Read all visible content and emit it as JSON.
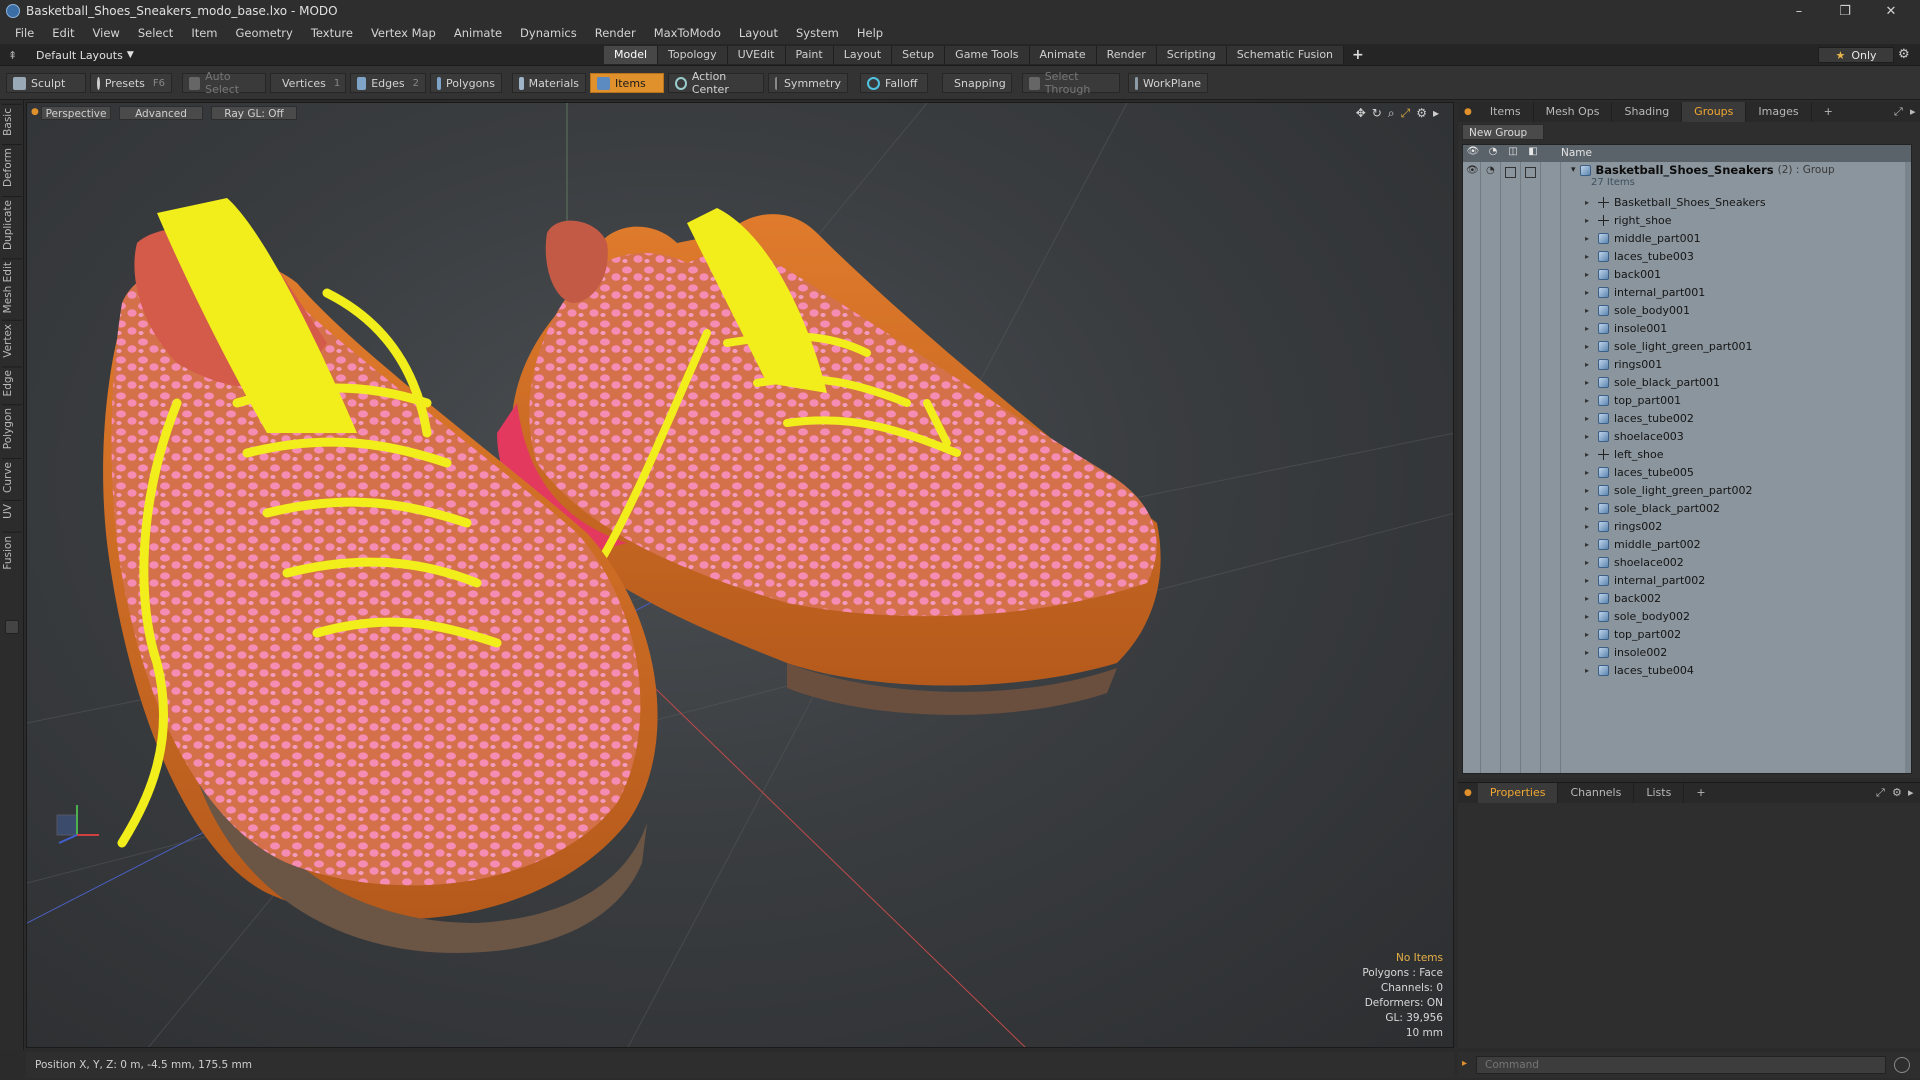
{
  "window": {
    "title": "Basketball_Shoes_Sneakers_modo_base.lxo - MODO",
    "controls": [
      "–",
      "❐",
      "✕"
    ]
  },
  "menu": [
    "File",
    "Edit",
    "View",
    "Select",
    "Item",
    "Geometry",
    "Texture",
    "Vertex Map",
    "Animate",
    "Dynamics",
    "Render",
    "MaxToModo",
    "Layout",
    "System",
    "Help"
  ],
  "layouts": {
    "label": "Default Layouts",
    "tabs": [
      "Model",
      "Topology",
      "UVEdit",
      "Paint",
      "Layout",
      "Setup",
      "Game Tools",
      "Animate",
      "Render",
      "Scripting",
      "Schematic Fusion"
    ],
    "active_tab": "Model",
    "plus": "+",
    "only_label": "Only"
  },
  "toolbar": {
    "sculpt": "Sculpt",
    "presets": "Presets",
    "presets_key": "F6",
    "auto_select": "Auto Select",
    "vertices": "Vertices",
    "vertices_count": "1",
    "edges": "Edges",
    "edges_count": "2",
    "polygons": "Polygons",
    "materials": "Materials",
    "items": "Items",
    "action_center": "Action Center",
    "symmetry": "Symmetry",
    "falloff": "Falloff",
    "snapping": "Snapping",
    "select_through": "Select Through",
    "workplane": "WorkPlane"
  },
  "left_tabs": [
    "Basic",
    "Deform",
    "Duplicate",
    "Mesh Edit",
    "Vertex",
    "Edge",
    "Polygon",
    "Curve",
    "UV",
    "Fusion"
  ],
  "viewport": {
    "view": "Perspective",
    "shading": "Advanced",
    "raygl": "Ray GL: Off",
    "info": {
      "items": "No Items",
      "polygons": "Polygons : Face",
      "channels": "Channels: 0",
      "deformers": "Deformers: ON",
      "gl": "GL: 39,956",
      "grid": "10 mm"
    }
  },
  "status": {
    "position": "Position X, Y, Z:  0 m, -4.5 mm, 175.5 mm"
  },
  "right_panel": {
    "tabs": [
      "Items",
      "Mesh Ops",
      "Shading",
      "Groups",
      "Images"
    ],
    "active_tab": "Groups",
    "new_group": "New Group",
    "col_name": "Name",
    "group": {
      "name": "Basketball_Shoes_Sneakers",
      "meta": "(2) : Group",
      "count": "27 Items"
    },
    "items": [
      {
        "name": "Basketball_Shoes_Sneakers",
        "type": "locator"
      },
      {
        "name": "right_shoe",
        "type": "locator"
      },
      {
        "name": "middle_part001",
        "type": "mesh"
      },
      {
        "name": "laces_tube003",
        "type": "mesh"
      },
      {
        "name": "back001",
        "type": "mesh"
      },
      {
        "name": "internal_part001",
        "type": "mesh"
      },
      {
        "name": "sole_body001",
        "type": "mesh"
      },
      {
        "name": "insole001",
        "type": "mesh"
      },
      {
        "name": "sole_light_green_part001",
        "type": "mesh"
      },
      {
        "name": "rings001",
        "type": "mesh"
      },
      {
        "name": "sole_black_part001",
        "type": "mesh"
      },
      {
        "name": "top_part001",
        "type": "mesh"
      },
      {
        "name": "laces_tube002",
        "type": "mesh"
      },
      {
        "name": "shoelace003",
        "type": "mesh"
      },
      {
        "name": "left_shoe",
        "type": "locator"
      },
      {
        "name": "laces_tube005",
        "type": "mesh"
      },
      {
        "name": "sole_light_green_part002",
        "type": "mesh"
      },
      {
        "name": "sole_black_part002",
        "type": "mesh"
      },
      {
        "name": "rings002",
        "type": "mesh"
      },
      {
        "name": "middle_part002",
        "type": "mesh"
      },
      {
        "name": "shoelace002",
        "type": "mesh"
      },
      {
        "name": "internal_part002",
        "type": "mesh"
      },
      {
        "name": "back002",
        "type": "mesh"
      },
      {
        "name": "sole_body002",
        "type": "mesh"
      },
      {
        "name": "top_part002",
        "type": "mesh"
      },
      {
        "name": "insole002",
        "type": "mesh"
      },
      {
        "name": "laces_tube004",
        "type": "mesh"
      }
    ]
  },
  "properties_panel": {
    "tabs": [
      "Properties",
      "Channels",
      "Lists"
    ],
    "active_tab": "Properties"
  },
  "command": {
    "placeholder": "Command"
  },
  "colors": {
    "accent": "#e0912b",
    "tab_active_text": "#f0a733",
    "shoe_pink": "#e66fa0",
    "shoe_orange": "#d9732e",
    "lace_yellow": "#f2ee1c"
  }
}
